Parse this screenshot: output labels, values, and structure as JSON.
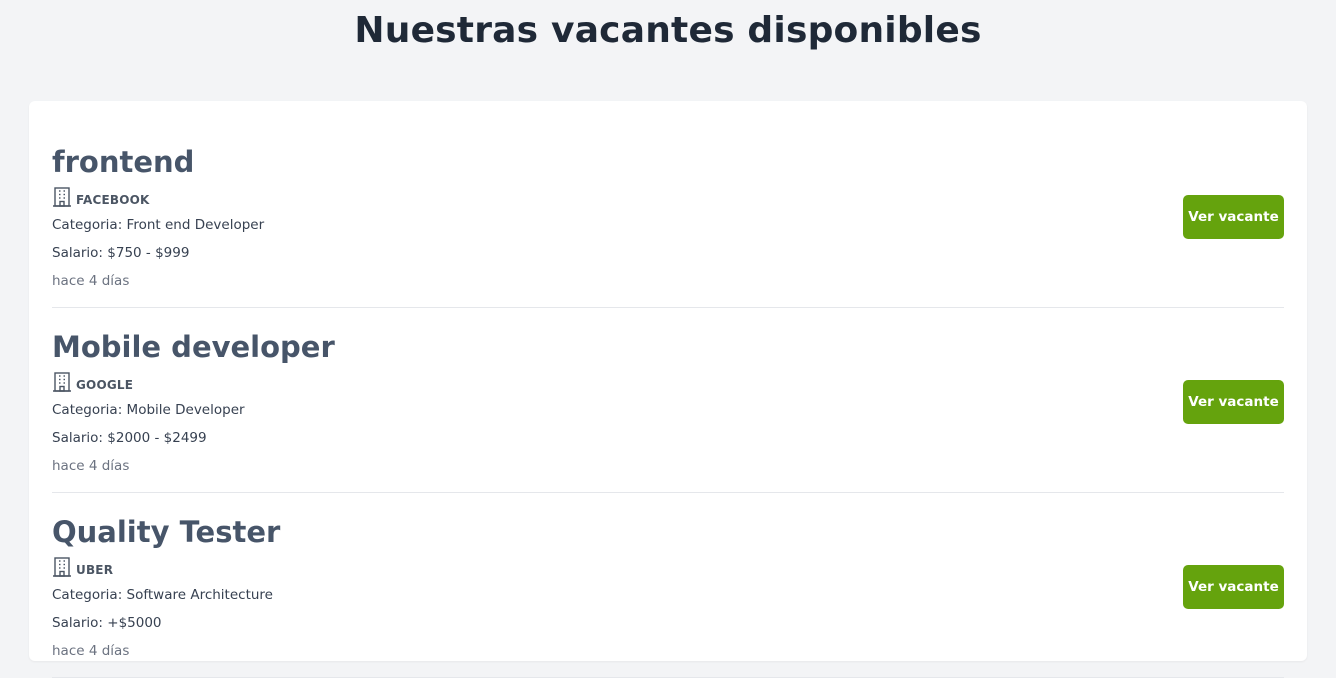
{
  "header": {
    "title": "Nuestras vacantes disponibles"
  },
  "accent_color": "#65a30d",
  "vacancies": [
    {
      "title": "frontend",
      "company": "FACEBOOK",
      "company_icon": "building-icon",
      "category": "Categoria: Front end Developer",
      "salary": "Salario: $750 - $999",
      "posted": "hace 4 días",
      "button_label": "Ver vacante"
    },
    {
      "title": "Mobile developer",
      "company": "GOOGLE",
      "company_icon": "building-icon",
      "category": "Categoria: Mobile Developer",
      "salary": "Salario: $2000 - $2499",
      "posted": "hace 4 días",
      "button_label": "Ver vacante"
    },
    {
      "title": "Quality Tester",
      "company": "UBER",
      "company_icon": "building-icon",
      "category": "Categoria: Software Architecture",
      "salary": "Salario: +$5000",
      "posted": "hace 4 días",
      "button_label": "Ver vacante"
    }
  ]
}
